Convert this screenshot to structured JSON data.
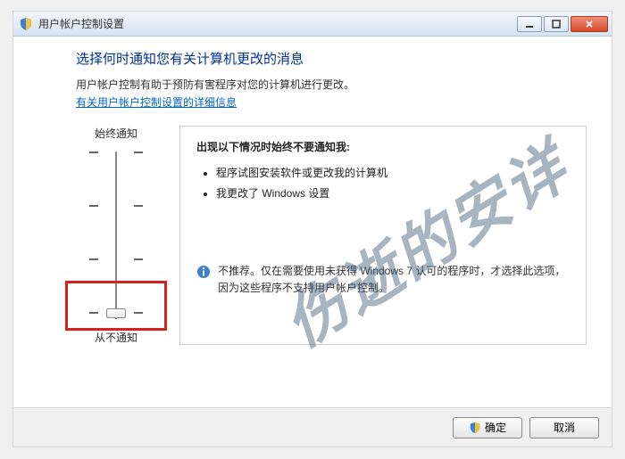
{
  "window": {
    "title": "用户帐户控制设置"
  },
  "page": {
    "heading": "选择何时通知您有关计算机更改的消息",
    "description": "用户帐户控制有助于预防有害程序对您的计算机进行更改。",
    "link": "有关用户帐户控制设置的详细信息"
  },
  "slider": {
    "top_label": "始终通知",
    "bottom_label": "从不通知",
    "tick_count": 4,
    "position_index": 3
  },
  "info": {
    "title": "出现以下情况时始终不要通知我:",
    "items": [
      "程序试图安装软件或更改我的计算机",
      "我更改了 Windows 设置"
    ],
    "note": "不推荐。仅在需要使用未获得 Windows 7 认可的程序时，才选择此选项，因为这些程序不支持用户帐户控制。"
  },
  "buttons": {
    "ok": "确定",
    "cancel": "取消"
  },
  "watermark": "伤逝的安详"
}
